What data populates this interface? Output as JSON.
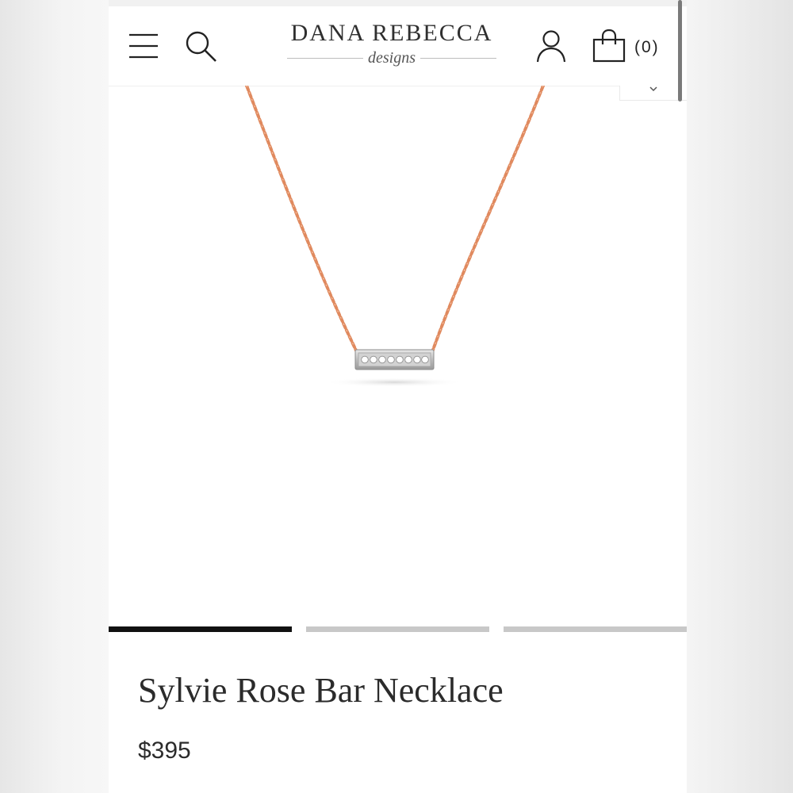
{
  "header": {
    "menu_icon": "hamburger-menu-icon",
    "search_icon": "search-icon",
    "brand_name": "DANA REBECCA",
    "brand_tagline": "designs",
    "account_icon": "user-icon",
    "cart_icon": "shopping-bag-icon",
    "cart_count": "(0)"
  },
  "gallery": {
    "image_count": 3,
    "active_index": 0,
    "chain_color": "#e08a5f",
    "indicator_active_color": "#111111",
    "indicator_inactive_color": "#c8c8c8"
  },
  "product": {
    "title": "Sylvie Rose Bar Necklace",
    "price": "$395"
  }
}
